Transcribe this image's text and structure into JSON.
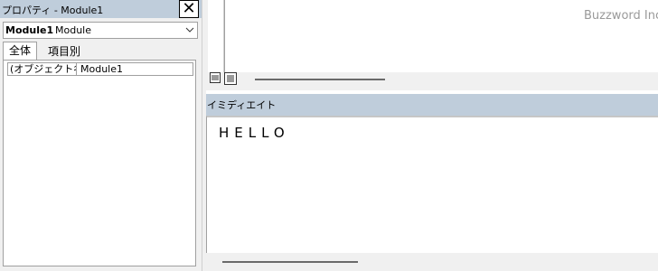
{
  "properties": {
    "title": "プロパティ - Module1",
    "object": {
      "name": "Module1",
      "type": "Module"
    },
    "tabs": [
      {
        "label": "全体"
      },
      {
        "label": "項目別"
      }
    ],
    "rows": [
      {
        "name": "(オブジェクト名)",
        "value": "Module1"
      }
    ]
  },
  "code_window": {
    "watermark": "Buzzword Inc."
  },
  "immediate": {
    "title": "イミディエイト",
    "content": "HELLO"
  },
  "icons": {
    "close": "close-icon",
    "dropdown": "chevron-down-icon",
    "procedure_view": "procedure-view-icon",
    "module_view": "full-module-view-icon"
  }
}
